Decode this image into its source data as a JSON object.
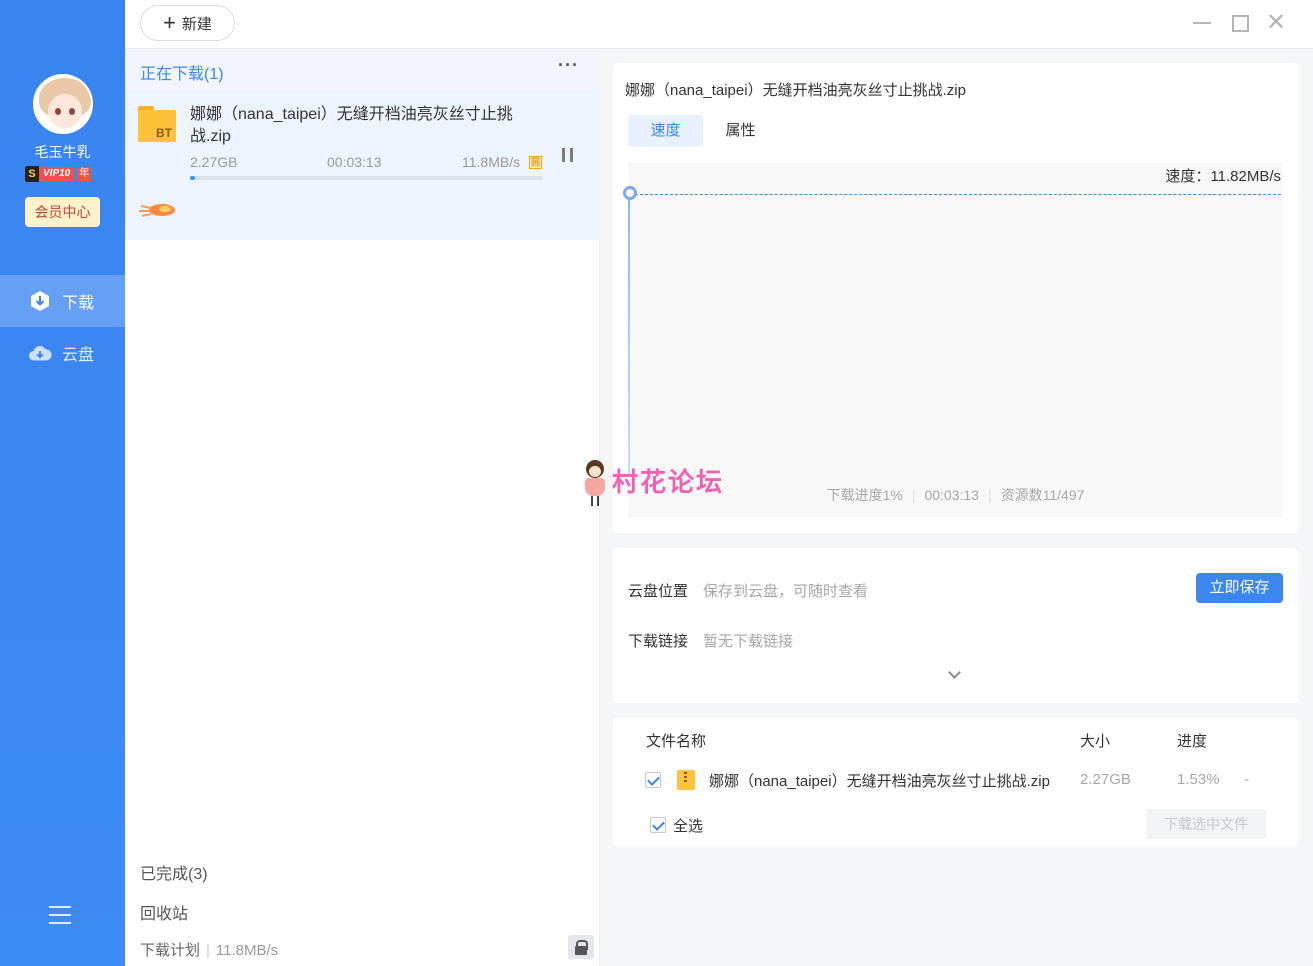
{
  "topbar": {
    "new_label": "新建"
  },
  "user": {
    "name": "毛玉牛乳",
    "vip_label": "VIP10",
    "vip_year": "年",
    "member_center": "会员中心"
  },
  "nav": {
    "download": "下载",
    "cloud": "云盘"
  },
  "list": {
    "header": "正在下载(1)",
    "more": "···",
    "task": {
      "name": "娜娜（nana_taipei）无缝开档油亮灰丝寸止挑战.zip",
      "folder_tag": "BT",
      "size": "2.27GB",
      "time": "00:03:13",
      "speed": "11.8MB/s",
      "speed_badge": "圆",
      "progress_fraction": 0.015
    },
    "completed": "已完成(3)",
    "trash": "回收站",
    "plan_label": "下载计划",
    "plan_speed": "11.8MB/s"
  },
  "detail": {
    "title": "娜娜（nana_taipei）无缝开档油亮灰丝寸止挑战.zip",
    "tab_speed": "速度",
    "tab_attr": "属性",
    "speed_readout": "速度：11.82MB/s",
    "progress_text": "下载进度1%",
    "elapsed": "00:03:13",
    "sources": "资源数11/497"
  },
  "save": {
    "cloud_location_label": "云盘位置",
    "cloud_location_value": "保存到云盘，可随时查看",
    "save_now": "立即保存",
    "link_label": "下载链接",
    "link_value": "暂无下载链接"
  },
  "files": {
    "col_name": "文件名称",
    "col_size": "大小",
    "col_progress": "进度",
    "rows": [
      {
        "name": "娜娜（nana_taipei）无缝开档油亮灰丝寸止挑战.zip",
        "size": "2.27GB",
        "progress": "1.53%",
        "extra": "-"
      }
    ],
    "select_all": "全选",
    "download_selected": "下载选中文件"
  },
  "watermark": {
    "text": "村花论坛"
  },
  "colors": {
    "sidebar": "#3a84f0",
    "accent": "#3c86f0",
    "folder": "#ffc23b",
    "watermark": "#f25fb3"
  }
}
